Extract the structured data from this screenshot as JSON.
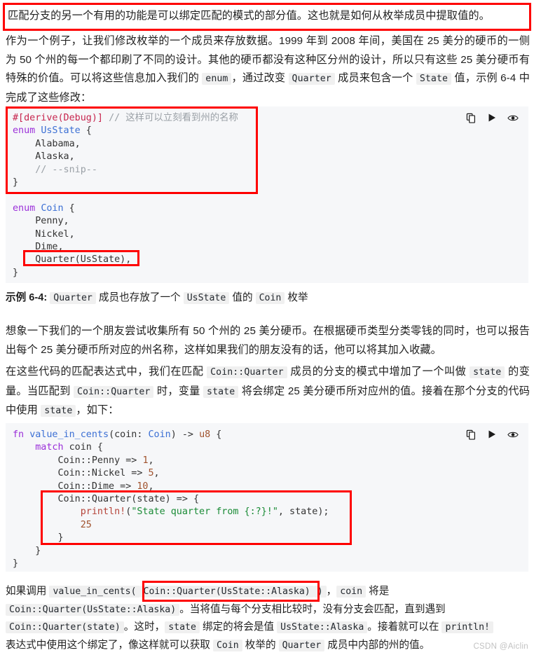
{
  "page": {
    "watermark": "CSDN @Aiclin",
    "accent_red": "#fe0000",
    "code_bg": "#f6f7f9",
    "inline_code_bg": "#f0f0f0"
  },
  "intro": {
    "highlighted_note": "匹配分支的另一个有用的功能是可以绑定匹配的模式的部分值。这也就是如何从枚举成员中提取值的。",
    "paragraph_part1": "作为一个例子，让我们修改枚举的一个成员来存放数据。1999 年到 2008 年间，美国在 25 美分的硬币的一侧为 50 个州的每一个都印刷了不同的设计。其他的硬币都没有这种区分州的设计，所以只有这些 25 美分硬币有特殊的价值。可以将这些信息加入我们的 ",
    "code_enum": "enum",
    "paragraph_part2": "，通过改变 ",
    "code_quarter": "Quarter",
    "paragraph_part3": " 成员来包含一个 ",
    "code_state": "State",
    "paragraph_part4": " 值，示例 6-4 中完成了这些修改："
  },
  "code_block_1": {
    "tools": [
      {
        "icon": "copy-icon",
        "label": "复制"
      },
      {
        "icon": "run-icon",
        "label": "运行"
      },
      {
        "icon": "eye-icon",
        "label": "预览"
      }
    ],
    "lines": [
      [
        {
          "t": "#[derive(Debug)]",
          "c": "tok-attr"
        },
        {
          "t": " ",
          "c": "tok-plain"
        },
        {
          "t": "// 这样可以立刻看到州的名称",
          "c": "tok-cmt"
        }
      ],
      [
        {
          "t": "enum",
          "c": "tok-kw"
        },
        {
          "t": " ",
          "c": "tok-plain"
        },
        {
          "t": "UsState",
          "c": "tok-type"
        },
        {
          "t": " {",
          "c": "tok-plain"
        }
      ],
      [
        {
          "t": "    Alabama,",
          "c": "tok-plain"
        }
      ],
      [
        {
          "t": "    Alaska,",
          "c": "tok-plain"
        }
      ],
      [
        {
          "t": "    ",
          "c": "tok-plain"
        },
        {
          "t": "// --snip--",
          "c": "tok-cmt"
        }
      ],
      [
        {
          "t": "}",
          "c": "tok-plain"
        }
      ],
      [
        {
          "t": "",
          "c": "tok-plain"
        }
      ],
      [
        {
          "t": "enum",
          "c": "tok-kw"
        },
        {
          "t": " ",
          "c": "tok-plain"
        },
        {
          "t": "Coin",
          "c": "tok-type"
        },
        {
          "t": " {",
          "c": "tok-plain"
        }
      ],
      [
        {
          "t": "    Penny,",
          "c": "tok-plain"
        }
      ],
      [
        {
          "t": "    Nickel,",
          "c": "tok-plain"
        }
      ],
      [
        {
          "t": "    Dime,",
          "c": "tok-plain"
        }
      ],
      [
        {
          "t": "    Quarter(UsState),",
          "c": "tok-plain"
        }
      ],
      [
        {
          "t": "}",
          "c": "tok-plain"
        }
      ]
    ]
  },
  "caption": {
    "prefix": "示例 6-4:",
    "code_quarter": "Quarter",
    "mid1": " 成员也存放了一个 ",
    "code_usstate": "UsState",
    "mid2": " 值的 ",
    "code_coin": "Coin",
    "suffix": " 枚举"
  },
  "body": {
    "paragraph_1": "想象一下我们的一个朋友尝试收集所有 50 个州的 25 美分硬币。在根据硬币类型分类零钱的同时，也可以报告出每个 25 美分硬币所对应的州名称，这样如果我们的朋友没有的话，他可以将其加入收藏。",
    "p2_a": "在这些代码的匹配表达式中，我们在匹配 ",
    "p2_code1": "Coin::Quarter",
    "p2_b": " 成员的分支的模式中增加了一个叫做 ",
    "p2_code2": "state",
    "p2_c": " 的变量。当匹配到 ",
    "p2_code3": "Coin::Quarter",
    "p2_d": " 时，变量 ",
    "p2_code4": "state",
    "p2_e": " 将会绑定 25 美分硬币所对应州的值。接着在那个分支的代码中使用 ",
    "p2_code5": "state",
    "p2_f": "，如下："
  },
  "code_block_2": {
    "tools": [
      {
        "icon": "copy-icon",
        "label": "复制"
      },
      {
        "icon": "run-icon",
        "label": "运行"
      },
      {
        "icon": "eye-icon",
        "label": "预览"
      }
    ],
    "lines": [
      [
        {
          "t": "fn",
          "c": "tok-kw"
        },
        {
          "t": " ",
          "c": "tok-plain"
        },
        {
          "t": "value_in_cents",
          "c": "tok-fn"
        },
        {
          "t": "(coin: ",
          "c": "tok-plain"
        },
        {
          "t": "Coin",
          "c": "tok-type"
        },
        {
          "t": ") -> ",
          "c": "tok-plain"
        },
        {
          "t": "u8",
          "c": "tok-prim"
        },
        {
          "t": " {",
          "c": "tok-plain"
        }
      ],
      [
        {
          "t": "    ",
          "c": "tok-plain"
        },
        {
          "t": "match",
          "c": "tok-kw"
        },
        {
          "t": " coin {",
          "c": "tok-plain"
        }
      ],
      [
        {
          "t": "        Coin::Penny => ",
          "c": "tok-plain"
        },
        {
          "t": "1",
          "c": "tok-num"
        },
        {
          "t": ",",
          "c": "tok-plain"
        }
      ],
      [
        {
          "t": "        Coin::Nickel => ",
          "c": "tok-plain"
        },
        {
          "t": "5",
          "c": "tok-num"
        },
        {
          "t": ",",
          "c": "tok-plain"
        }
      ],
      [
        {
          "t": "        Coin::Dime => ",
          "c": "tok-plain"
        },
        {
          "t": "10",
          "c": "tok-num"
        },
        {
          "t": ",",
          "c": "tok-plain"
        }
      ],
      [
        {
          "t": "        Coin::Quarter(state) => {",
          "c": "tok-plain"
        }
      ],
      [
        {
          "t": "            ",
          "c": "tok-plain"
        },
        {
          "t": "println!",
          "c": "tok-macro"
        },
        {
          "t": "(",
          "c": "tok-plain"
        },
        {
          "t": "\"State quarter from {:?}!\"",
          "c": "tok-str"
        },
        {
          "t": ", state);",
          "c": "tok-plain"
        }
      ],
      [
        {
          "t": "            ",
          "c": "tok-plain"
        },
        {
          "t": "25",
          "c": "tok-num"
        }
      ],
      [
        {
          "t": "        }",
          "c": "tok-plain"
        }
      ],
      [
        {
          "t": "    }",
          "c": "tok-plain"
        }
      ],
      [
        {
          "t": "}",
          "c": "tok-plain"
        }
      ]
    ]
  },
  "footer": {
    "l1_a": "如果调用 ",
    "l1_code1": "value_in_cents(",
    "l1_code2": "Coin::Quarter(UsState::Alaska)",
    "l1_code3": ")",
    "l1_b": "，",
    "l1_c": "coin",
    "l1_d": " 将是",
    "l2_code1": "Coin::Quarter(UsState::Alaska)",
    "l2_a": "。当将值与每个分支相比较时，没有分支会匹配，直到遇到",
    "l3_code1": "Coin::Quarter(state)",
    "l3_a": "。这时，",
    "l3_code2": "state",
    "l3_b": " 绑定的将会是值 ",
    "l3_code3": "UsState::Alaska",
    "l3_c": "。接着就可以在 ",
    "l3_code4": "println!",
    "l4_a": "表达式中使用这个绑定了，像这样就可以获取 ",
    "l4_code1": "Coin",
    "l4_b": " 枚举的 ",
    "l4_code2": "Quarter",
    "l4_c": " 成员中内部的州的值。"
  }
}
